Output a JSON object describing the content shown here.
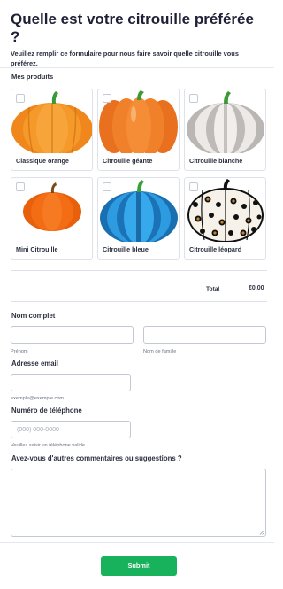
{
  "form": {
    "title": "Quelle est votre citrouille préférée ?",
    "subtitle": "Veuillez remplir ce formulaire pour nous faire savoir quelle citrouille vous préférez."
  },
  "products": {
    "label": "Mes produits",
    "items": [
      {
        "label": "Classique orange",
        "checked": false,
        "color": "#f28a1e"
      },
      {
        "label": "Citrouille géante",
        "checked": false,
        "color": "#ee7a2a"
      },
      {
        "label": "Citrouille blanche",
        "checked": false,
        "color": "#e8e5e2"
      },
      {
        "label": "Mini Citrouille",
        "checked": false,
        "color": "#f26a12"
      },
      {
        "label": "Citrouille bleue",
        "checked": false,
        "color": "#2f9fe0"
      },
      {
        "label": "Citrouille léopard",
        "checked": false,
        "color": "#f6f2ea"
      }
    ],
    "total_label": "Total",
    "total_value": "€0.00"
  },
  "name": {
    "label": "Nom complet",
    "first_sublabel": "Prénom",
    "last_sublabel": "Nom de famille",
    "first_value": "",
    "last_value": ""
  },
  "email": {
    "label": "Adresse email",
    "sublabel": "exemple@exemple.com",
    "value": ""
  },
  "phone": {
    "label": "Numéro de téléphone",
    "placeholder": "(000) 000-0000",
    "sublabel": "Veuillez saisir un téléphone valide.",
    "value": ""
  },
  "comments": {
    "label": "Avez-vous d'autres commentaires ou suggestions ?",
    "value": ""
  },
  "submit": {
    "label": "Submit",
    "color": "#18b15c"
  }
}
